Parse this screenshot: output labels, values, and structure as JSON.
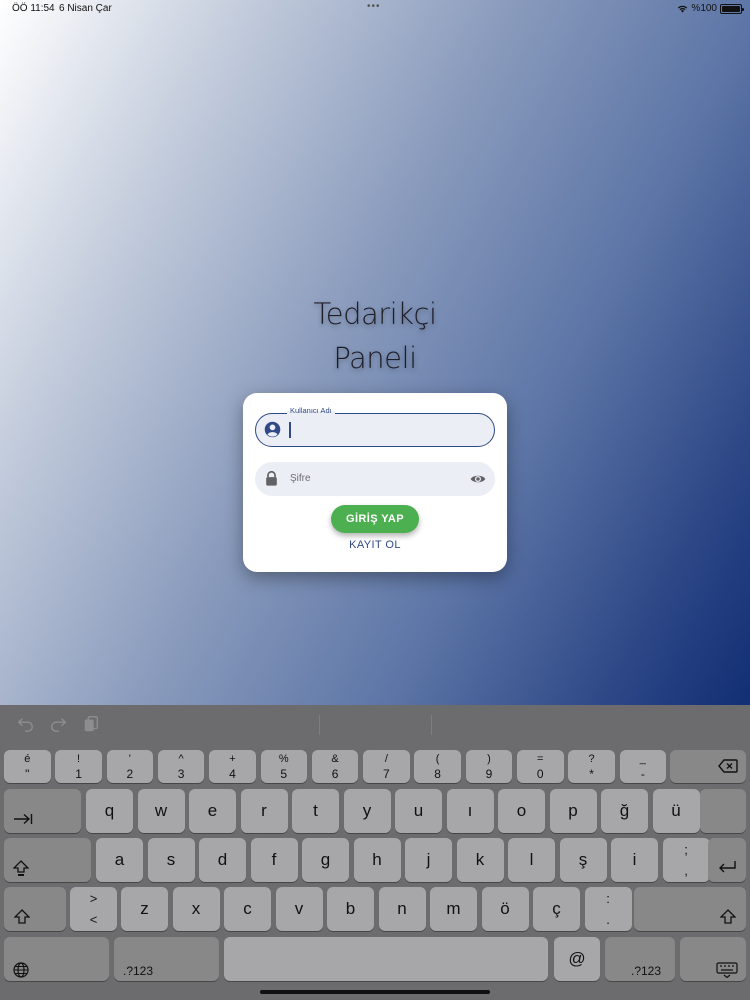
{
  "status_bar": {
    "time": "ÖÖ 11:54",
    "date": "6 Nisan Çar",
    "dots": "•••",
    "battery_text": "%100"
  },
  "title": {
    "line1": "Tedarikçi",
    "line2": "Paneli"
  },
  "login_form": {
    "username": {
      "label": "Kullanıcı Adı",
      "value": "",
      "icon": "account-circle-icon"
    },
    "password": {
      "placeholder": "Şifre",
      "icon": "lock-icon",
      "toggle_icon": "eye-icon"
    },
    "login_button": "GİRİŞ YAP",
    "register_link": "KAYIT OL"
  },
  "colors": {
    "accent_green": "#4caf50",
    "brand_blue": "#2f4a86",
    "gradient_end": "#122f74"
  },
  "keyboard": {
    "toolbar_icons": [
      "undo-icon",
      "redo-icon",
      "paste-icon"
    ],
    "number_row": [
      {
        "top": "é",
        "bottom": "\""
      },
      {
        "top": "!",
        "bottom": "1"
      },
      {
        "top": "'",
        "bottom": "2"
      },
      {
        "top": "^",
        "bottom": "3"
      },
      {
        "top": "+",
        "bottom": "4"
      },
      {
        "top": "%",
        "bottom": "5"
      },
      {
        "top": "&",
        "bottom": "6"
      },
      {
        "top": "/",
        "bottom": "7"
      },
      {
        "top": "(",
        "bottom": "8"
      },
      {
        "top": ")",
        "bottom": "9"
      },
      {
        "top": "=",
        "bottom": "0"
      },
      {
        "top": "?",
        "bottom": "*"
      },
      {
        "top": "_",
        "bottom": "-"
      }
    ],
    "row_q": [
      "q",
      "w",
      "e",
      "r",
      "t",
      "y",
      "u",
      "ı",
      "o",
      "p",
      "ğ",
      "ü"
    ],
    "row_a": [
      "a",
      "s",
      "d",
      "f",
      "g",
      "h",
      "j",
      "k",
      "l",
      "ş",
      "i"
    ],
    "row_a_extra": {
      "top": ";",
      "bottom": ","
    },
    "row_z_first": {
      "top": ">",
      "bottom": "<"
    },
    "row_z": [
      "z",
      "x",
      "c",
      "v",
      "b",
      "n",
      "m",
      "ö",
      "ç"
    ],
    "row_z_last": {
      "top": ":",
      "bottom": "."
    },
    "bottom_row": {
      "numbers_left": ".?123",
      "at": "@",
      "numbers_right": ".?123"
    }
  }
}
